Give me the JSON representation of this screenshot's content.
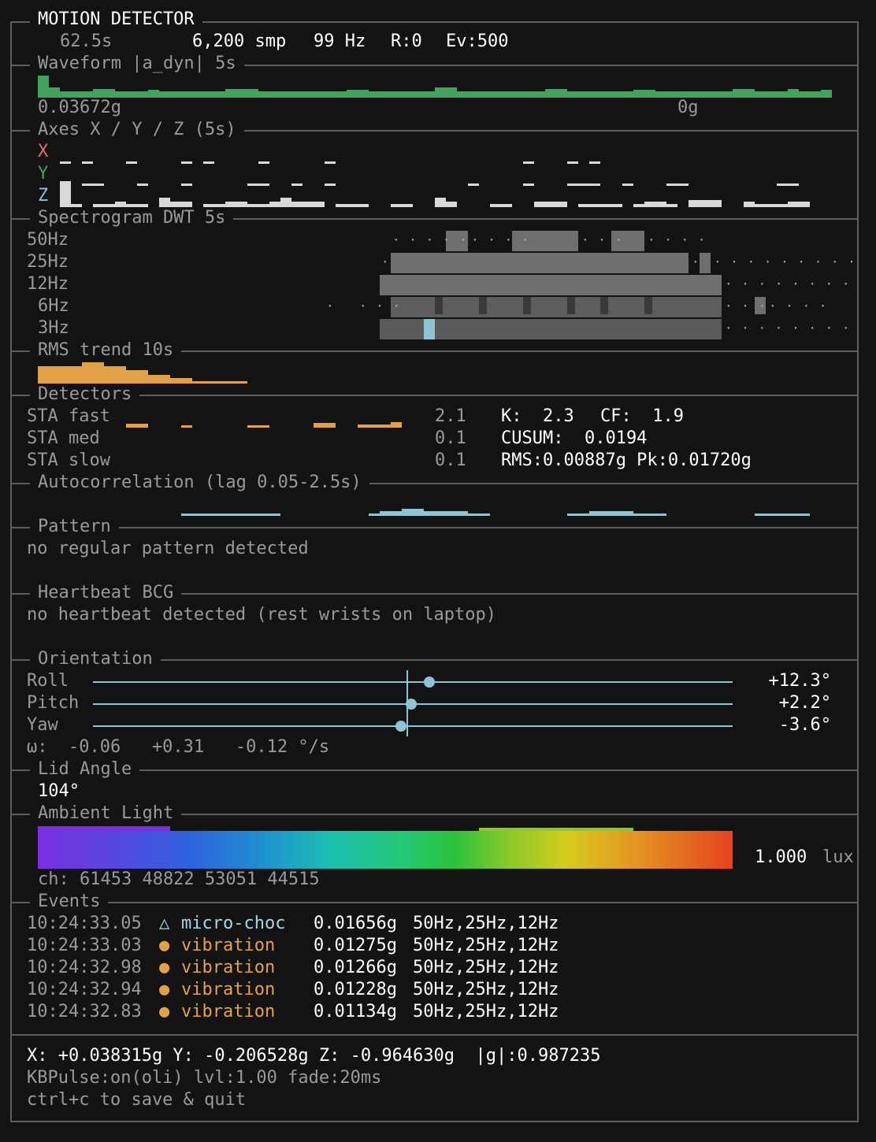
{
  "header": {
    "title": "MOTION DETECTOR",
    "elapsed": "62.5s",
    "samples": "6,200 smp",
    "rate": "99 Hz",
    "r": "R:0",
    "ev": "Ev:500"
  },
  "waveform": {
    "title": "Waveform |a_dyn| 5s",
    "max_label": "0.03672g",
    "zero_label": "0g",
    "color": "#41a35c"
  },
  "axes": {
    "title": "Axes X / Y / Z (5s)",
    "x_label": "X",
    "y_label": "Y",
    "z_label": "Z",
    "x_color": "#e06c75",
    "y_color": "#41a35c",
    "z_color": "#8ec4d3"
  },
  "spectrogram": {
    "title": "Spectrogram DWT 5s",
    "bands": [
      "50Hz",
      "25Hz",
      "12Hz",
      "6Hz",
      "3Hz"
    ]
  },
  "rms_trend": {
    "title": "RMS trend 10s",
    "color": "#e3a248"
  },
  "detectors": {
    "title": "Detectors",
    "rows": [
      {
        "label": "STA fast",
        "value": "2.1"
      },
      {
        "label": "STA med",
        "value": "0.1"
      },
      {
        "label": "STA slow",
        "value": "0.1"
      }
    ],
    "kurtosis": "K:  2.3",
    "crest": "CF:  1.9",
    "cusum": "CUSUM:  0.0194",
    "rms_pk": "RMS:0.00887g Pk:0.01720g"
  },
  "autocorrelation": {
    "title": "Autocorrelation (lag 0.05-2.5s)"
  },
  "pattern": {
    "title": "Pattern",
    "text": "no regular pattern detected"
  },
  "heartbeat": {
    "title": "Heartbeat BCG",
    "text": "no heartbeat detected (rest wrists on laptop)"
  },
  "orientation": {
    "title": "Orientation",
    "rows": [
      {
        "label": "Roll",
        "value": "+12.3°",
        "level": 12.3
      },
      {
        "label": "Pitch",
        "value": "+2.2°",
        "level": 2.2
      },
      {
        "label": "Yaw",
        "value": "-3.6°",
        "level": -3.6
      }
    ],
    "omega": "ω:  -0.06   +0.31   -0.12 °/s"
  },
  "lid": {
    "title": "Lid Angle",
    "value": "104°"
  },
  "ambient": {
    "title": "Ambient Light",
    "lux_value": "1.000",
    "lux_unit": "lux",
    "channels": "ch: 61453 48822 53051 44515"
  },
  "events": {
    "title": "Events",
    "items": [
      {
        "time": "10:24:33.05",
        "icon": "△",
        "type": "micro-choc",
        "amp": "0.01656g",
        "bands": "50Hz,25Hz,12Hz",
        "kind": "cyan"
      },
      {
        "time": "10:24:33.03",
        "icon": "●",
        "type": "vibration",
        "amp": "0.01275g",
        "bands": "50Hz,25Hz,12Hz",
        "kind": "orange"
      },
      {
        "time": "10:24:32.98",
        "icon": "●",
        "type": "vibration",
        "amp": "0.01266g",
        "bands": "50Hz,25Hz,12Hz",
        "kind": "orange"
      },
      {
        "time": "10:24:32.94",
        "icon": "●",
        "type": "vibration",
        "amp": "0.01228g",
        "bands": "50Hz,25Hz,12Hz",
        "kind": "orange"
      },
      {
        "time": "10:24:32.83",
        "icon": "●",
        "type": "vibration",
        "amp": "0.01134g",
        "bands": "50Hz,25Hz,12Hz",
        "kind": "orange"
      }
    ]
  },
  "footer": {
    "gravity": "X: +0.038315g Y: -0.206528g Z: -0.964630g  |g|:0.987235",
    "kbpulse": "KBPulse:on(oli) lvl:1.00 fade:20ms",
    "quit": "ctrl+c to save & quit"
  }
}
